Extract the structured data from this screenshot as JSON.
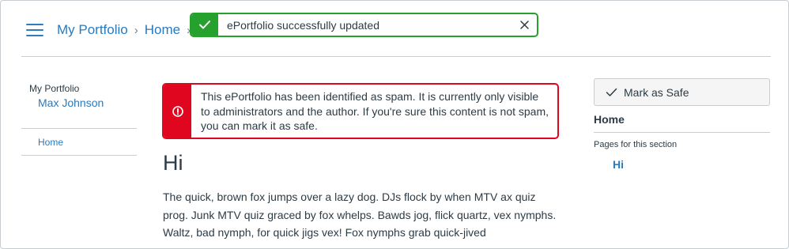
{
  "breadcrumb": {
    "items": [
      "My Portfolio",
      "Home"
    ]
  },
  "toast": {
    "message": "ePortfolio successfully updated",
    "status_color": "#26a12e"
  },
  "left_sidebar": {
    "portfolio_label": "My Portfolio",
    "owner_name": "Max Johnson",
    "nav_items": [
      "Home"
    ]
  },
  "alert": {
    "message": "This ePortfolio has been identified as spam. It is currently only visible to administrators and the author. If you're sure this content is not spam, you can mark it as safe.",
    "status_color": "#e0061f"
  },
  "main": {
    "title": "Hi",
    "body": "The quick, brown fox jumps over a lazy dog. DJs flock by when MTV ax quiz prog. Junk MTV quiz graced by fox whelps. Bawds jog, flick quartz, vex nymphs. Waltz, bad nymph, for quick jigs vex! Fox nymphs grab quick-jived"
  },
  "right_sidebar": {
    "mark_safe_label": "Mark as Safe",
    "section_title": "Home",
    "pages_label": "Pages for this section",
    "pages": [
      "Hi"
    ]
  },
  "colors": {
    "link": "#2b7abc",
    "text": "#2d3b45"
  },
  "icons": {
    "menu": "hamburger-menu-icon",
    "toast_status": "checkmark-icon",
    "toast_close": "close-icon",
    "alert_status": "warning-icon",
    "mark_safe": "checkmark-icon"
  }
}
